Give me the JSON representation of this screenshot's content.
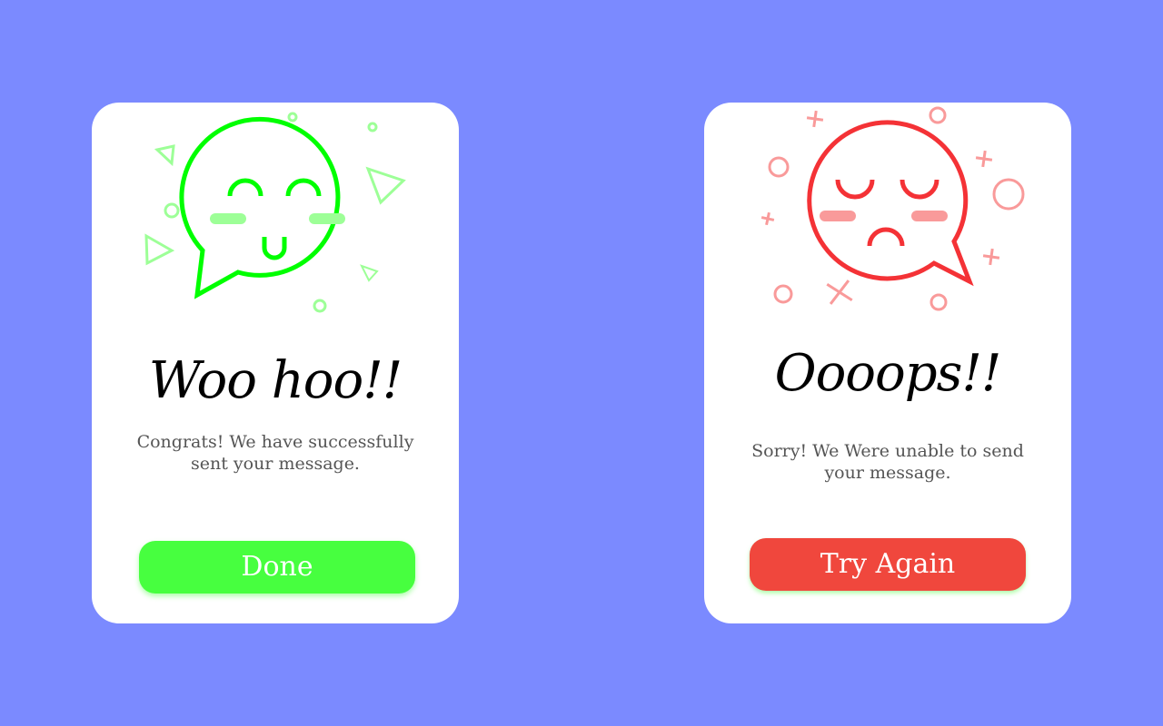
{
  "colors": {
    "background": "#7b8aff",
    "card": "#ffffff",
    "success_accent": "#00ff00",
    "success_light": "#9dff97",
    "success_button": "#47ff3f",
    "error_accent": "#f43236",
    "error_light": "#f99a9a",
    "error_button": "#f0473d"
  },
  "success_card": {
    "icon": "happy-speech-bubble-icon",
    "title": "Woo hoo!!",
    "message": "Congrats! We have successfully sent your message.",
    "button_label": "Done"
  },
  "error_card": {
    "icon": "sad-speech-bubble-icon",
    "title": "Oooops!!",
    "message": "Sorry! We Were unable to send your message.",
    "button_label": "Try Again"
  }
}
